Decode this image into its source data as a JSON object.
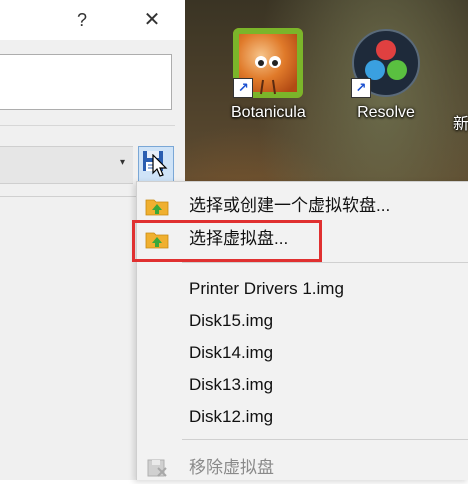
{
  "dialog": {
    "help_label": "?",
    "close_label": "✕",
    "combo_arrow": "▾"
  },
  "desktop": {
    "icons": [
      {
        "label": "Botanicula"
      },
      {
        "label": "Resolve"
      },
      {
        "label": "新"
      }
    ]
  },
  "menu": {
    "items": [
      {
        "label": "选择或创建一个虚拟软盘..."
      },
      {
        "label": "选择虚拟盘..."
      },
      {
        "label": "Printer Drivers 1.img"
      },
      {
        "label": "Disk15.img"
      },
      {
        "label": "Disk14.img"
      },
      {
        "label": "Disk13.img"
      },
      {
        "label": "Disk12.img"
      },
      {
        "label": "移除虚拟盘"
      }
    ]
  },
  "colors": {
    "highlight": "#e03030",
    "folder": "#f0b030",
    "arrow": "#3aa83a"
  }
}
